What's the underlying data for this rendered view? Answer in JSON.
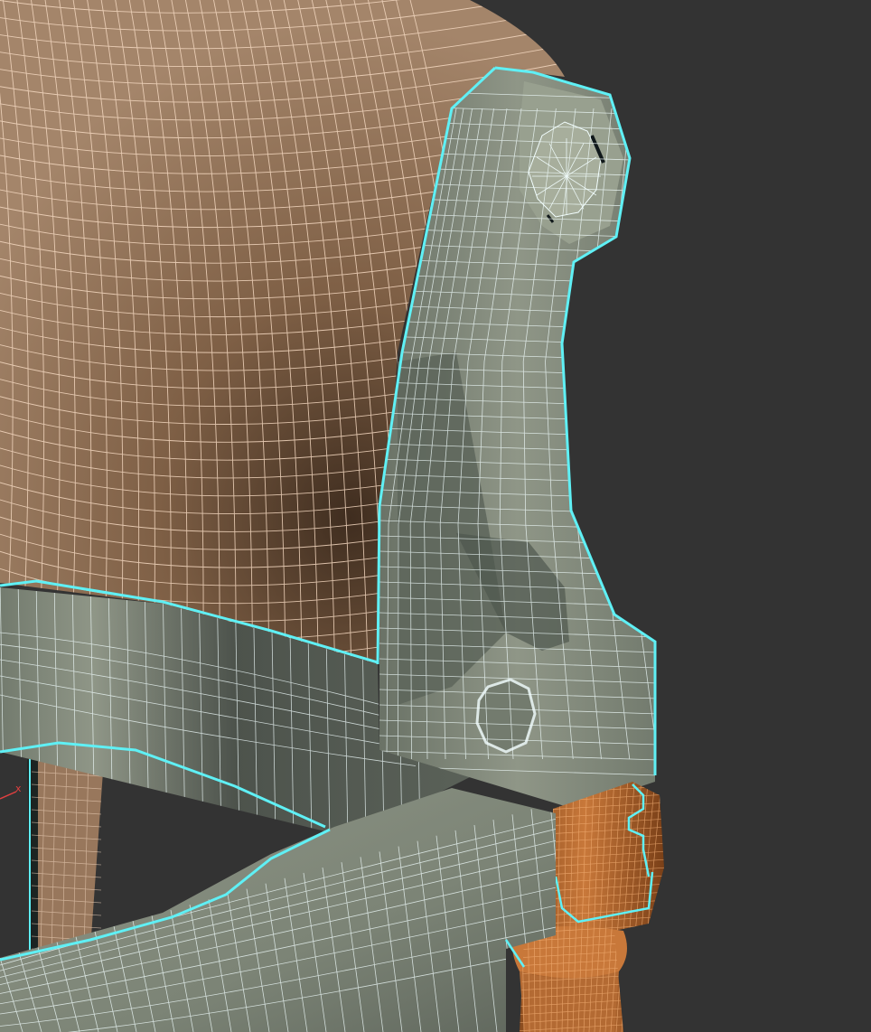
{
  "viewport": {
    "background": "#333333",
    "selection_color": "#5FF0F5",
    "wire_color": "#F3FFFF",
    "fabric_wire_color": "#F5D9C1"
  },
  "materials": {
    "fabric_light": "#A4856A",
    "fabric_mid": "#7E5F45",
    "fabric_dark": "#3F2D1F",
    "wood_light": "#8F9687",
    "wood_mid": "#737B6E",
    "wood_dark": "#4D534C",
    "leg_orange": "#C8783A",
    "leg_dark": "#8A4C1F",
    "back_leg_tan": "#98775C"
  },
  "axis_gizmo": {
    "x_label": "x",
    "x_color": "#E04040"
  },
  "objects": [
    {
      "name": "seat-back-fabric",
      "selected": false
    },
    {
      "name": "armrest-scroll-frame",
      "selected": true
    },
    {
      "name": "seat-apron-rail",
      "selected": true
    },
    {
      "name": "front-leg-turned",
      "selected": false
    },
    {
      "name": "rear-leg",
      "selected": false
    }
  ]
}
